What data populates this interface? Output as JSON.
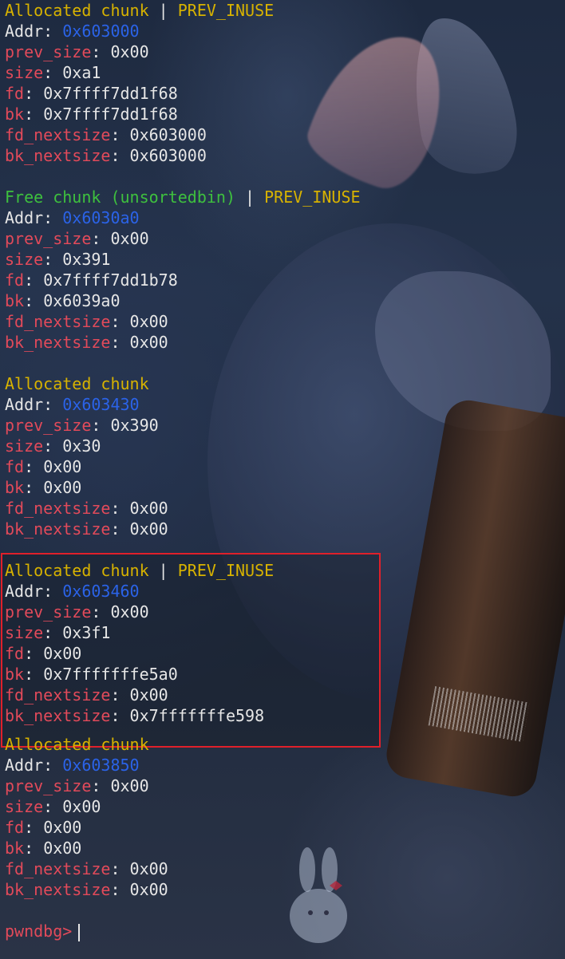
{
  "chunks": [
    {
      "status": "Allocated chunk",
      "flag": "PREV_INUSE",
      "addr": "0x603000",
      "prev_size": "0x00",
      "size": "0xa1",
      "fd": "0x7ffff7dd1f68",
      "bk": "0x7ffff7dd1f68",
      "fd_nextsize": "0x603000",
      "bk_nextsize": "0x603000"
    },
    {
      "status": "Free chunk (unsortedbin)",
      "flag": "PREV_INUSE",
      "addr": "0x6030a0",
      "prev_size": "0x00",
      "size": "0x391",
      "fd": "0x7ffff7dd1b78",
      "bk": "0x6039a0",
      "fd_nextsize": "0x00",
      "bk_nextsize": "0x00"
    },
    {
      "status": "Allocated chunk",
      "addr": "0x603430",
      "prev_size": "0x390",
      "size": "0x30",
      "fd": "0x00",
      "bk": "0x00",
      "fd_nextsize": "0x00",
      "bk_nextsize": "0x00"
    },
    {
      "status": "Allocated chunk",
      "flag": "PREV_INUSE",
      "addr": "0x603460",
      "prev_size": "0x00",
      "size": "0x3f1",
      "fd": "0x00",
      "bk": "0x7fffffffe5a0",
      "fd_nextsize": "0x00",
      "bk_nextsize": "0x7fffffffe598"
    },
    {
      "status": "Allocated chunk",
      "addr": "0x603850",
      "prev_size": "0x00",
      "size": "0x00",
      "fd": "0x00",
      "bk": "0x00",
      "fd_nextsize": "0x00",
      "bk_nextsize": "0x00"
    }
  ],
  "labels": {
    "sep": " | ",
    "addr": "Addr",
    "prev_size": "prev_size",
    "size": "size",
    "fd": "fd",
    "bk": "bk",
    "fd_nextsize": "fd_nextsize",
    "bk_nextsize": "bk_nextsize",
    "colon": ": "
  },
  "prompt": "pwndbg>",
  "colors": {
    "status_allocated": "#d7b200",
    "status_free": "#3ec03e",
    "field_name": "#e24a5a",
    "address": "#2b63e8",
    "highlight_border": "#e0202a"
  },
  "icons": {
    "cursor": "text-cursor-icon"
  }
}
